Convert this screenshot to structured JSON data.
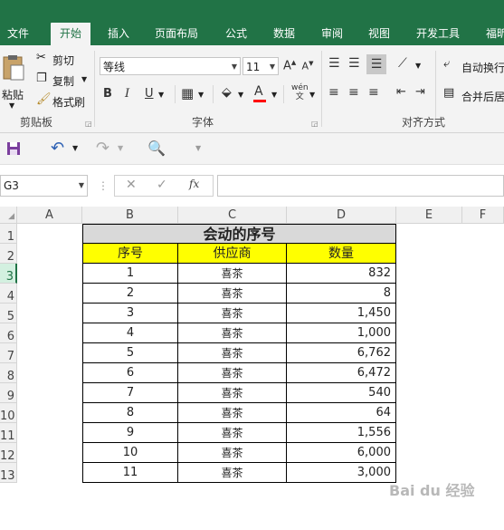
{
  "ribbon_tabs": [
    "文件",
    "开始",
    "插入",
    "页面布局",
    "公式",
    "数据",
    "审阅",
    "视图",
    "开发工具",
    "福昕"
  ],
  "clipboard": {
    "paste": "粘贴",
    "cut": "剪切",
    "copy": "复制",
    "format_painter": "格式刷",
    "group_label": "剪贴板"
  },
  "font": {
    "name": "等线",
    "size": "11",
    "group_label": "字体",
    "bold": "B",
    "italic": "I",
    "underline": "U",
    "font_color_letter": "A"
  },
  "alignment": {
    "wrap_text": "自动换行",
    "merge_center": "合并后居",
    "group_label": "对齐方式"
  },
  "formula_bar": {
    "name_box": "G3",
    "fx": "fx",
    "formula": ""
  },
  "colors": {
    "accent": "#217346",
    "header_fill": "#d9d9d9",
    "yellow_fill": "#ffff00",
    "font_red": "#ff0000"
  },
  "sheet": {
    "columns": [
      "A",
      "B",
      "C",
      "D",
      "E",
      "F"
    ],
    "row_numbers": [
      "1",
      "2",
      "3",
      "4",
      "5",
      "6",
      "7",
      "8",
      "9",
      "10",
      "11",
      "12",
      "13"
    ],
    "active_row": "3",
    "title": "会动的序号",
    "headers": [
      "序号",
      "供应商",
      "数量"
    ],
    "rows": [
      [
        "1",
        "喜茶",
        "832"
      ],
      [
        "2",
        "喜茶",
        "8"
      ],
      [
        "3",
        "喜茶",
        "1,450"
      ],
      [
        "4",
        "喜茶",
        "1,000"
      ],
      [
        "5",
        "喜茶",
        "6,762"
      ],
      [
        "6",
        "喜茶",
        "6,472"
      ],
      [
        "7",
        "喜茶",
        "540"
      ],
      [
        "8",
        "喜茶",
        "64"
      ],
      [
        "9",
        "喜茶",
        "1,556"
      ],
      [
        "10",
        "喜茶",
        "6,000"
      ],
      [
        "11",
        "喜茶",
        "3,000"
      ]
    ]
  },
  "watermark": "Bai du 经验"
}
